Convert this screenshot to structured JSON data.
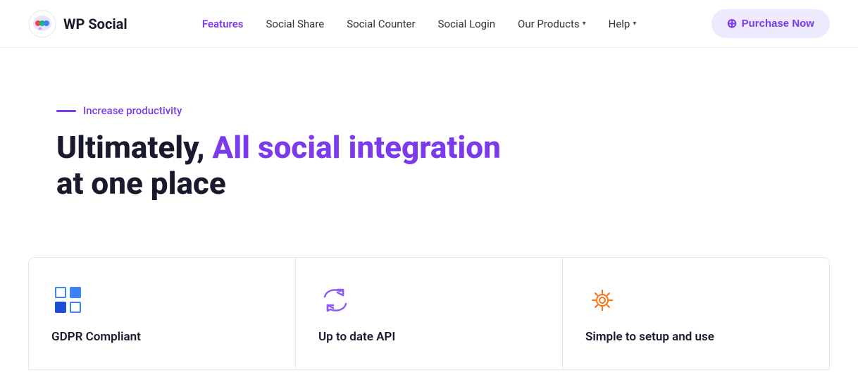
{
  "header": {
    "logo_text": "WP Social",
    "nav_items": [
      {
        "label": "Features",
        "active": true,
        "has_arrow": false
      },
      {
        "label": "Social Share",
        "active": false,
        "has_arrow": false
      },
      {
        "label": "Social Counter",
        "active": false,
        "has_arrow": false
      },
      {
        "label": "Social Login",
        "active": false,
        "has_arrow": false
      },
      {
        "label": "Our Products",
        "active": false,
        "has_arrow": true
      },
      {
        "label": "Help",
        "active": false,
        "has_arrow": true
      }
    ],
    "purchase_button": "Purchase Now"
  },
  "hero": {
    "tagline": "Increase productivity",
    "title_part1": "Ultimately, ",
    "title_highlight": "All social integration",
    "title_part2": "at one place"
  },
  "cards": [
    {
      "id": "gdpr",
      "label": "GDPR Compliant",
      "icon_type": "gdpr"
    },
    {
      "id": "api",
      "label": "Up to date API",
      "icon_type": "api"
    },
    {
      "id": "setup",
      "label": "Simple to setup and use",
      "icon_type": "gear"
    }
  ]
}
